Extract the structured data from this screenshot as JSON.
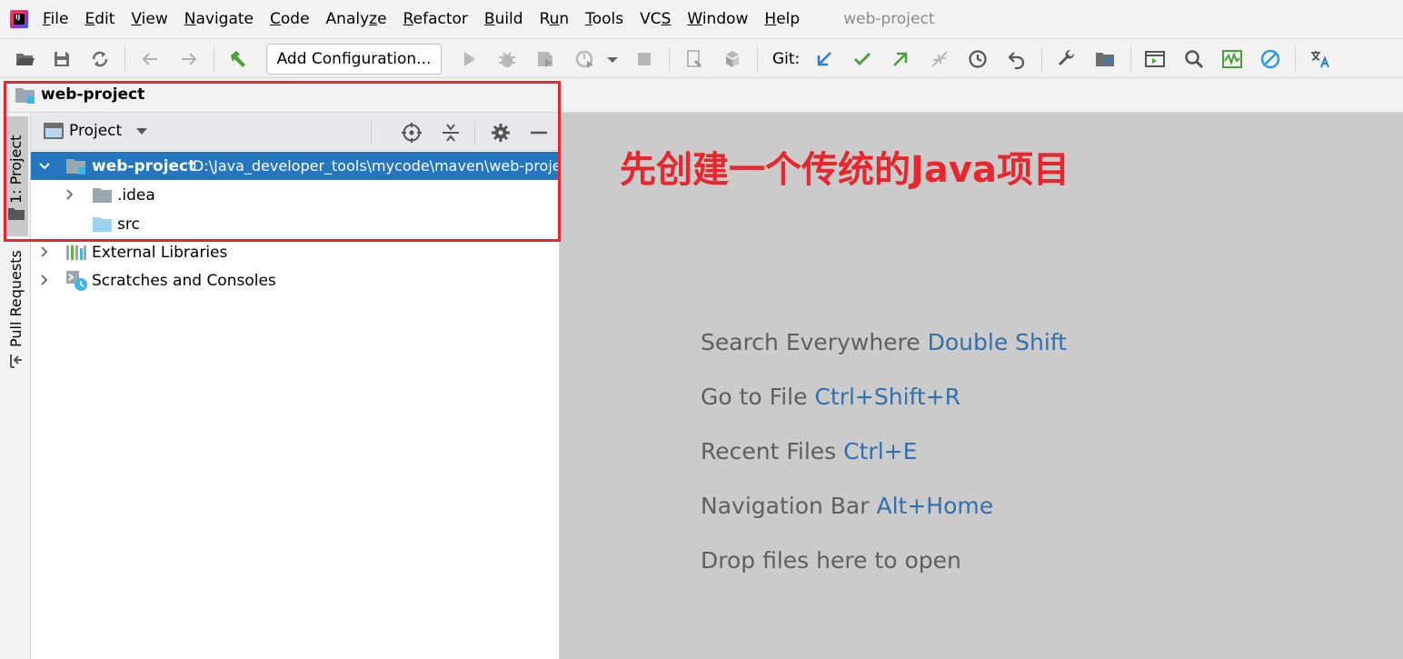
{
  "menubar": {
    "items": [
      {
        "pre": "",
        "u": "F",
        "post": "ile"
      },
      {
        "pre": "",
        "u": "E",
        "post": "dit"
      },
      {
        "pre": "",
        "u": "V",
        "post": "iew"
      },
      {
        "pre": "",
        "u": "N",
        "post": "avigate"
      },
      {
        "pre": "",
        "u": "C",
        "post": "ode"
      },
      {
        "pre": "Analy",
        "u": "z",
        "post": "e"
      },
      {
        "pre": "",
        "u": "R",
        "post": "efactor"
      },
      {
        "pre": "",
        "u": "B",
        "post": "uild"
      },
      {
        "pre": "R",
        "u": "u",
        "post": "n"
      },
      {
        "pre": "",
        "u": "T",
        "post": "ools"
      },
      {
        "pre": "VC",
        "u": "S",
        "post": ""
      },
      {
        "pre": "",
        "u": "W",
        "post": "indow"
      },
      {
        "pre": "",
        "u": "H",
        "post": "elp"
      }
    ],
    "window_title": "web-project"
  },
  "toolbar": {
    "add_configuration_label": "Add Configuration...",
    "git_label": "Git:",
    "icons": [
      "open-icon",
      "save-icon",
      "sync-icon",
      "back-icon",
      "forward-icon",
      "build-icon",
      "run-icon",
      "debug-icon",
      "coverage-icon",
      "profile-icon",
      "stop-icon",
      "attach-icon",
      "services-icon",
      "vcs-update-icon",
      "vcs-commit-icon",
      "vcs-push-icon",
      "vcs-merge-icon",
      "history-icon",
      "rollback-icon",
      "settings-icon",
      "project-structure-icon",
      "terminal-icon",
      "search-icon",
      "monitor-icon",
      "power-save-icon",
      "translate-icon"
    ]
  },
  "navbar": {
    "project_name": "web-project"
  },
  "left_strip": {
    "project_tab": "1: Project",
    "pull_requests_tab": "Pull Requests"
  },
  "project_panel": {
    "view_title": "Project",
    "tree": [
      {
        "label": "web-project",
        "path": "D:\\Java_developer_tools\\mycode\\maven\\web-project",
        "selected": true,
        "expanded": true
      },
      {
        "label": ".idea",
        "expanded": false
      },
      {
        "label": "src"
      },
      {
        "label": "External Libraries",
        "expanded": false
      },
      {
        "label": "Scratches and Consoles",
        "expanded": false
      }
    ]
  },
  "editor": {
    "annotation": "先创建一个传统的Java项目",
    "annotation_color": "#e8262e",
    "hints": [
      {
        "text": "Search Everywhere",
        "key": "Double Shift"
      },
      {
        "text": "Go to File",
        "key": "Ctrl+Shift+R"
      },
      {
        "text": "Recent Files",
        "key": "Ctrl+E"
      },
      {
        "text": "Navigation Bar",
        "key": "Alt+Home"
      },
      {
        "text": "Drop files here to open",
        "key": ""
      }
    ]
  },
  "colors": {
    "selection": "#2675bf",
    "shortcut_key": "#336fab",
    "highlight_box": "#e8262e"
  }
}
